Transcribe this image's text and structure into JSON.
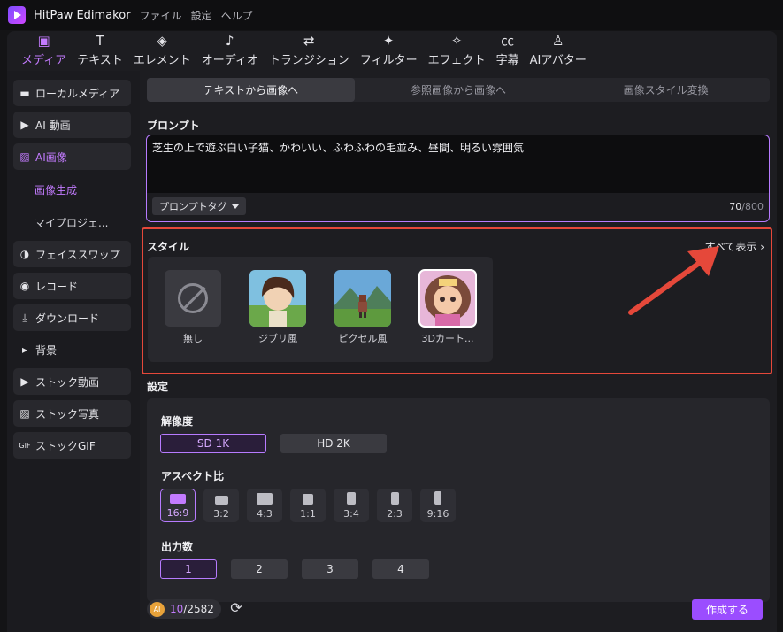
{
  "titlebar": {
    "app_name": "HitPaw Edimakor",
    "menu": [
      "ファイル",
      "設定",
      "ヘルプ"
    ]
  },
  "toptabs": [
    {
      "label": "メディア",
      "icon": "media-icon",
      "active": true
    },
    {
      "label": "テキスト",
      "icon": "text-icon"
    },
    {
      "label": "エレメント",
      "icon": "elements-icon"
    },
    {
      "label": "オーディオ",
      "icon": "audio-icon"
    },
    {
      "label": "トランジション",
      "icon": "transition-icon"
    },
    {
      "label": "フィルター",
      "icon": "filter-icon"
    },
    {
      "label": "エフェクト",
      "icon": "effect-icon"
    },
    {
      "label": "字幕",
      "icon": "subtitle-icon"
    },
    {
      "label": "AIアバター",
      "icon": "avatar-icon"
    }
  ],
  "sidebar": {
    "items": [
      {
        "label": "ローカルメディア",
        "icon": "folder-icon"
      },
      {
        "label": "AI 動画",
        "icon": "ai-video-icon"
      },
      {
        "label": "AI画像",
        "icon": "ai-image-icon",
        "active": true
      },
      {
        "label": "画像生成",
        "sub": true,
        "active": true
      },
      {
        "label": "マイプロジェ...",
        "sub": true
      },
      {
        "label": "フェイススワップ",
        "icon": "face-swap-icon"
      },
      {
        "label": "レコード",
        "icon": "record-icon"
      },
      {
        "label": "ダウンロード",
        "icon": "download-icon"
      },
      {
        "label": "背景",
        "icon": "caret-right-icon"
      },
      {
        "label": "ストック動画",
        "icon": "stock-video-icon"
      },
      {
        "label": "ストック写真",
        "icon": "stock-photo-icon"
      },
      {
        "label": "ストックGIF",
        "icon": "gif-icon"
      }
    ]
  },
  "main": {
    "subtabs": [
      "テキストから画像へ",
      "参照画像から画像へ",
      "画像スタイル変換"
    ],
    "prompt": {
      "label": "プロンプト",
      "text": "芝生の上で遊ぶ白い子猫、かわいい、ふわふわの毛並み、昼間、明るい雰囲気",
      "tag_button": "プロンプトタグ",
      "count": "70",
      "max": "/800"
    },
    "style": {
      "label": "スタイル",
      "show_all": "すべて表示",
      "items": [
        "無し",
        "ジブリ風",
        "ピクセル風",
        "3Dカート..."
      ]
    },
    "settings": {
      "label": "設定",
      "resolution_label": "解像度",
      "resolutions": [
        "SD 1K",
        "HD 2K"
      ],
      "aspect_label": "アスペクト比",
      "aspects": [
        "16:9",
        "3:2",
        "4:3",
        "1:1",
        "3:4",
        "2:3",
        "9:16"
      ],
      "output_label": "出力数",
      "outputs": [
        "1",
        "2",
        "3",
        "4"
      ]
    },
    "footer": {
      "coin_label": "AI",
      "credits_used": "10",
      "credits_total": "/2582",
      "create": "作成する"
    }
  },
  "colors": {
    "accent": "#c37bff",
    "highlight_frame": "#e5483a",
    "primary_button": "#9b4dff"
  }
}
